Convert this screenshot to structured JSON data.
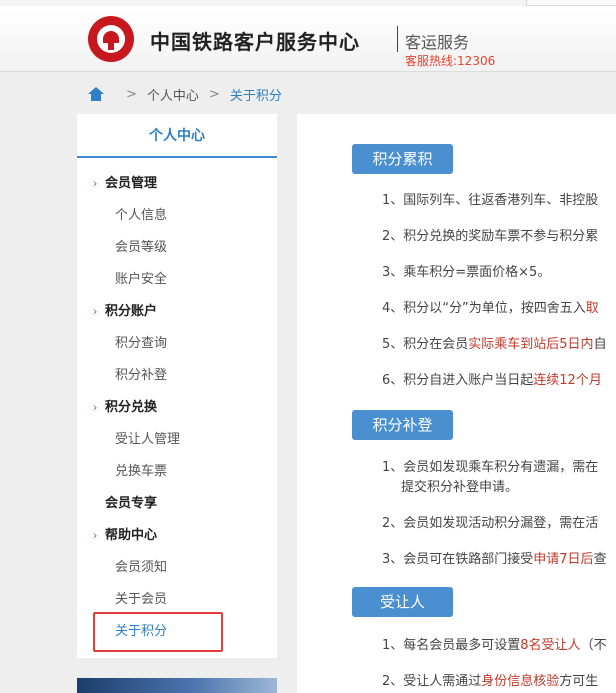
{
  "header": {
    "site_title": "中国铁路客户服务中心",
    "subtitle": "客运服务",
    "hotline": "客服热线:12306"
  },
  "breadcrumb": {
    "home_icon": "home-icon",
    "separator": ">",
    "items": [
      "个人中心",
      "关于积分"
    ]
  },
  "sidebar": {
    "title": "个人中心",
    "groups": [
      {
        "label": "会员管理",
        "items": [
          "个人信息",
          "会员等级",
          "账户安全"
        ]
      },
      {
        "label": "积分账户",
        "items": [
          "积分查询",
          "积分补登"
        ]
      },
      {
        "label": "积分兑换",
        "items": [
          "受让人管理",
          "兑换车票"
        ]
      },
      {
        "label": "会员专享",
        "items": []
      },
      {
        "label": "帮助中心",
        "items": [
          "会员须知",
          "关于会员",
          "关于积分"
        ]
      }
    ],
    "active_item": "关于积分"
  },
  "content": {
    "sections": [
      {
        "title": "积分累积",
        "lines": [
          {
            "pre": "1、国际列车、往返香港列车、非控股",
            "hl": ""
          },
          {
            "pre": "2、积分兑换的奖励车票不参与积分累",
            "hl": ""
          },
          {
            "pre": "3、乘车积分=票面价格×5。",
            "hl": ""
          },
          {
            "pre": "4、积分以“分”为单位，按四舍五入",
            "hl": "取"
          },
          {
            "pre": "5、积分在会员",
            "hl": "实际乘车到站后5日内",
            "post": "自"
          },
          {
            "pre": "6、积分自进入账户当日起",
            "hl": "连续12个月"
          }
        ]
      },
      {
        "title": "积分补登",
        "lines": [
          {
            "pre": "1、会员如发现乘车积分有遗漏，需在",
            "hl": ""
          },
          {
            "pre": "提交积分补登申请。",
            "hl": ""
          },
          {
            "pre": "2、会员如发现活动积分漏登，需在活",
            "hl": ""
          },
          {
            "pre": "3、会员可在铁路部门接受",
            "hl": "申请7日后",
            "post": "查"
          }
        ]
      },
      {
        "title": "受让人",
        "lines": [
          {
            "pre": "1、每名会员最多可设置",
            "hl": "8名受让人",
            "post": "（不"
          },
          {
            "pre": "2、受让人需通过",
            "hl": "身份信息核验",
            "post": "方可生"
          }
        ]
      }
    ]
  },
  "colors": {
    "accent": "#2f7fc6",
    "section_title_bg": "#4a90d0",
    "highlight_text": "#c0392b",
    "hotline": "#e8422f",
    "annotation_box": "#e23b3b"
  }
}
